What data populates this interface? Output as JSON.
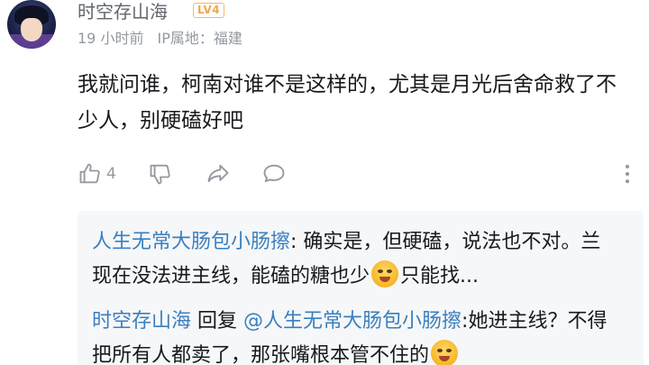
{
  "comment": {
    "username": "时空存山海",
    "level": "LV4",
    "time": "19 小时前",
    "ip_location": "IP属地：福建",
    "text": "我就问谁，柯南对谁不是这样的，尤其是月光后舍命救了不少人，别硬磕好吧",
    "like_count": "4"
  },
  "icons": {
    "like": "thumbs-up-icon",
    "dislike": "thumbs-down-icon",
    "share": "share-arrow-icon",
    "reply": "comment-bubble-icon",
    "more": "more-dots-icon",
    "emoji": "laughing-emoji-icon"
  },
  "replies": [
    {
      "author": "人生无常大肠包小肠擦",
      "text_before_emoji": ": 确实是，但硬磕，说法也不对。兰现在没法进主线，能磕的糖也少",
      "text_after_emoji": "只能找..."
    },
    {
      "author": "时空存山海",
      "reply_word": "回复",
      "mention": "@人生无常大肠包小肠擦",
      "text_before_emoji": ":她进主线？不得把所有人都卖了，那张嘴根本管不住的",
      "text_after_emoji": ""
    }
  ],
  "colors": {
    "link": "#3a7fbf",
    "meta": "#9499a0",
    "badge": "#f5a54a",
    "reply_bg": "#f6f7f8"
  }
}
